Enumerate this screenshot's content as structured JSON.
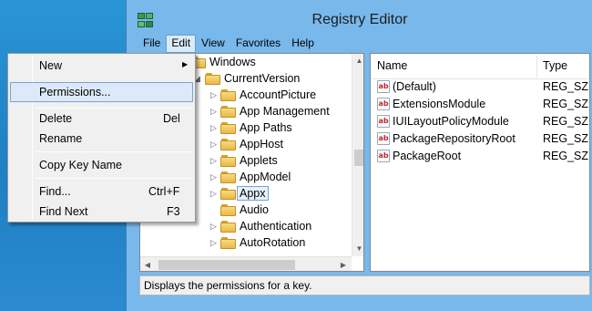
{
  "window": {
    "title": "Registry Editor",
    "icon": "registry-editor-icon"
  },
  "menubar": {
    "items": [
      "File",
      "Edit",
      "View",
      "Favorites",
      "Help"
    ],
    "active": "Edit"
  },
  "tree": {
    "items": [
      {
        "label": "Windows",
        "expander": "",
        "selected": false
      },
      {
        "label": "CurrentVersion",
        "expander": "down",
        "selected": false
      },
      {
        "label": "AccountPicture",
        "expander": "right",
        "selected": false
      },
      {
        "label": "App Management",
        "expander": "right",
        "selected": false
      },
      {
        "label": "App Paths",
        "expander": "right",
        "selected": false
      },
      {
        "label": "AppHost",
        "expander": "right",
        "selected": false
      },
      {
        "label": "Applets",
        "expander": "right",
        "selected": false
      },
      {
        "label": "AppModel",
        "expander": "right",
        "selected": false
      },
      {
        "label": "Appx",
        "expander": "right",
        "selected": true
      },
      {
        "label": "Audio",
        "expander": "",
        "selected": false
      },
      {
        "label": "Authentication",
        "expander": "right",
        "selected": false
      },
      {
        "label": "AutoRotation",
        "expander": "right",
        "selected": false
      }
    ]
  },
  "list": {
    "columns": [
      "Name",
      "Type"
    ],
    "rows": [
      {
        "name": "(Default)",
        "type": "REG_SZ",
        "icon": "string-value-icon"
      },
      {
        "name": "ExtensionsModule",
        "type": "REG_SZ",
        "icon": "string-value-icon"
      },
      {
        "name": "IUILayoutPolicyModule",
        "type": "REG_SZ",
        "icon": "string-value-icon"
      },
      {
        "name": "PackageRepositoryRoot",
        "type": "REG_SZ",
        "icon": "string-value-icon"
      },
      {
        "name": "PackageRoot",
        "type": "REG_SZ",
        "icon": "string-value-icon"
      }
    ],
    "icon_glyph": "ab"
  },
  "edit_menu": {
    "items": [
      {
        "label": "New",
        "shortcut": "",
        "submenu": true
      },
      {
        "label": "Permissions...",
        "shortcut": "",
        "highlighted": true
      },
      {
        "label": "Delete",
        "shortcut": "Del"
      },
      {
        "label": "Rename",
        "shortcut": ""
      },
      {
        "label": "Copy Key Name",
        "shortcut": ""
      },
      {
        "label": "Find...",
        "shortcut": "Ctrl+F"
      },
      {
        "label": "Find Next",
        "shortcut": "F3"
      }
    ]
  },
  "statusbar": {
    "text": "Displays the permissions for a key."
  },
  "colors": {
    "frame": "#78b8eb",
    "desktop": "#1f7fc3",
    "highlight": "#dbe9f8",
    "value_icon_red": "#c0262d"
  }
}
